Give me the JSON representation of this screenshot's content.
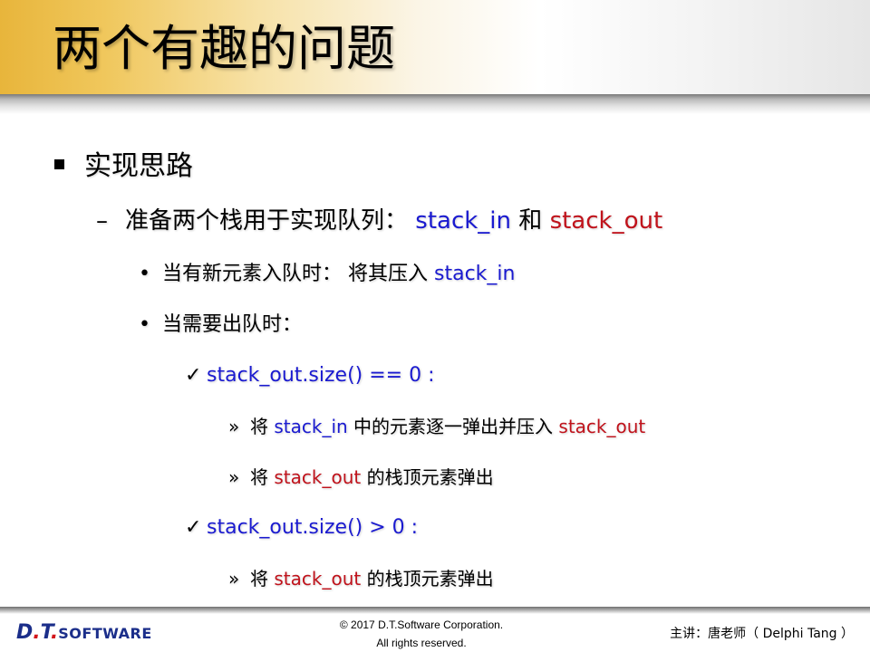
{
  "title": "两个有趣的问题",
  "bullets": {
    "l1": {
      "text": "实现思路"
    },
    "l2": {
      "marker": "–",
      "text": "准备两个栈用于实现队列：",
      "term_in": "stack_in",
      "and": "和",
      "term_out": "stack_out"
    },
    "l3a": {
      "marker": "•",
      "text": "当有新元素入队时： 将其压入",
      "term": "stack_in"
    },
    "l3b": {
      "marker": "•",
      "text": "当需要出队时："
    },
    "l4a": {
      "marker": "✓",
      "text": "stack_out.size() == 0 :"
    },
    "l5a": {
      "marker": "»",
      "pre": "将",
      "term1": "stack_in",
      "mid": "中的元素逐一弹出并压入",
      "term2": "stack_out"
    },
    "l5b": {
      "marker": "»",
      "pre": "将",
      "term": "stack_out",
      "post": "的栈顶元素弹出"
    },
    "l4b": {
      "marker": "✓",
      "text": "stack_out.size() > 0 :"
    },
    "l5c": {
      "marker": "»",
      "pre": "将",
      "term": "stack_out",
      "post": "的栈顶元素弹出"
    }
  },
  "footer": {
    "logo": {
      "dt_d": "D",
      "dt_dot1": ".",
      "dt_t": "T",
      "dt_dot2": ".",
      "software": "SOFTWARE"
    },
    "copyright_line1": "© 2017 D.T.Software Corporation.",
    "copyright_line2": "All rights reserved.",
    "speaker": "主讲：唐老师（ Delphi Tang ）"
  },
  "colors": {
    "accent_blue": "#1a1ad0",
    "accent_red": "#c0121b",
    "title_band": "#e8b53b",
    "logo_blue": "#1b2e8a",
    "logo_red": "#d3161b"
  }
}
